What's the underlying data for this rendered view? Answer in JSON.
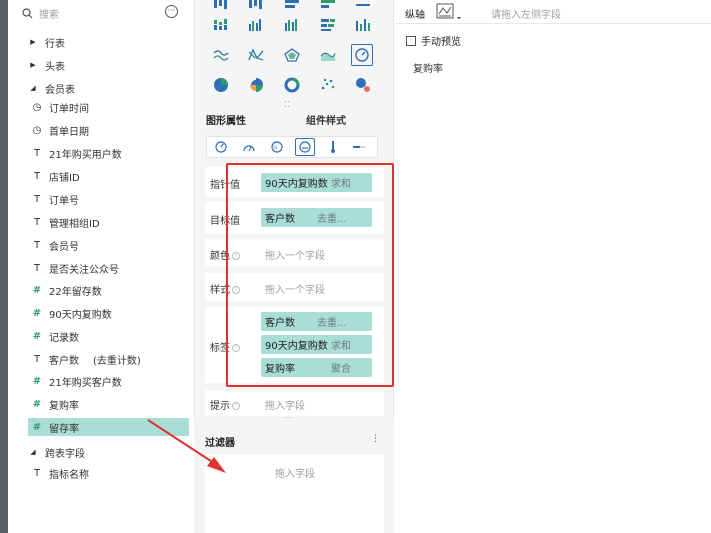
{
  "search": {
    "placeholder": "搜索",
    "more_icon": "more-horizontal-icon"
  },
  "tree": [
    {
      "type": "table",
      "label": "行表",
      "expanded": false
    },
    {
      "type": "table",
      "label": "头表",
      "expanded": false
    },
    {
      "type": "table",
      "label": "会员表",
      "expanded": true
    },
    {
      "type": "time",
      "icon": "◷",
      "label": "订单时间"
    },
    {
      "type": "time",
      "icon": "◷",
      "label": "首单日期"
    },
    {
      "type": "text",
      "icon": "T",
      "label": "21年购买用户数"
    },
    {
      "type": "text",
      "icon": "T",
      "label": "店铺ID"
    },
    {
      "type": "text",
      "icon": "T",
      "label": "订单号"
    },
    {
      "type": "text",
      "icon": "T",
      "label": "管理相组ID"
    },
    {
      "type": "text",
      "icon": "T",
      "label": "会员号"
    },
    {
      "type": "text",
      "icon": "T",
      "label": "是否关注公众号"
    },
    {
      "type": "number",
      "icon": "#",
      "label": "22年留存数"
    },
    {
      "type": "number",
      "icon": "#",
      "label": "90天内复购数"
    },
    {
      "type": "number",
      "icon": "#",
      "label": "记录数"
    },
    {
      "type": "text",
      "icon": "T",
      "label": "客户数",
      "suffix": "(去重计数)"
    },
    {
      "type": "calc",
      "icon": "#",
      "label": "21年购买客户数"
    },
    {
      "type": "calc",
      "icon": "#",
      "label": "复购率"
    },
    {
      "type": "calc",
      "icon": "#",
      "label": "留存率",
      "selected": true
    },
    {
      "type": "table",
      "label": "跨表字段",
      "expanded": true
    },
    {
      "type": "text",
      "icon": "T",
      "label": "指标名称"
    }
  ],
  "props": {
    "tab_active": "图形属性",
    "tab_inactive": "组件样式"
  },
  "rows": {
    "indicator": {
      "label": "指针值",
      "chips": [
        {
          "name": "90天内复购数",
          "agg": "求和"
        }
      ]
    },
    "target": {
      "label": "目标值",
      "chips": [
        {
          "name": "客户数",
          "agg": "去重..."
        }
      ]
    },
    "color": {
      "label": "颜色",
      "placeholder": "拖入一个字段"
    },
    "style": {
      "label": "样式",
      "placeholder": "拖入一个字段"
    },
    "tag": {
      "label": "标签",
      "chips": [
        {
          "name": "客户数",
          "agg": "去重..."
        },
        {
          "name": "90天内复购数",
          "agg": "求和"
        },
        {
          "name": "复购率",
          "agg": "聚合"
        }
      ]
    },
    "tooltip": {
      "label": "提示",
      "placeholder": "拖入字段"
    }
  },
  "filter": {
    "title": "过滤器",
    "placeholder": "拖入字段",
    "more": "⋮"
  },
  "right": {
    "y_axis_label": "纵轴",
    "y_axis_placeholder": "请拖入左侧字段",
    "manual_preview": "手动预览",
    "metric_name": "复购率"
  },
  "colors": {
    "chip": "#a9ddd6",
    "accent": "#2f6fb3",
    "highlight": "#e0322e",
    "calc_icon": "#2e9a6e"
  }
}
